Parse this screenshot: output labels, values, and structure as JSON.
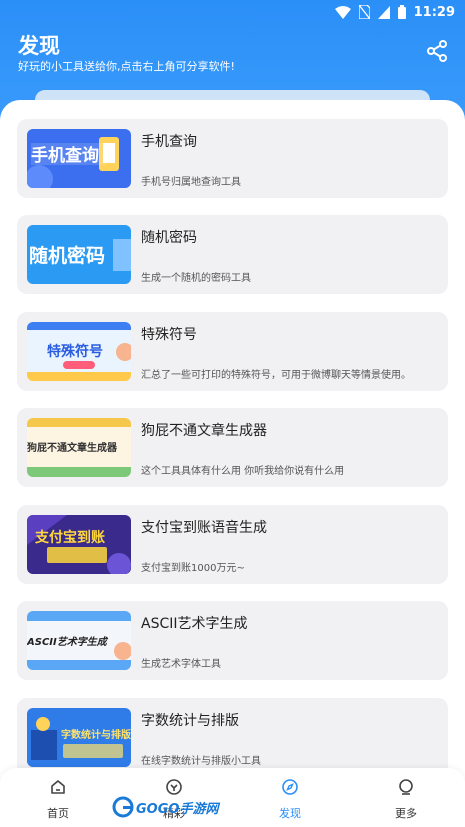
{
  "status": {
    "time": "11:29"
  },
  "header": {
    "title": "发现",
    "subtitle": "好玩的小工具送给你,点击右上角可分享软件!",
    "share_icon": "share-icon"
  },
  "colors": {
    "accent": "#2a8ff7",
    "card_bg": "#f1f1f3",
    "page_bg": "#ffffff"
  },
  "tools": [
    {
      "title": "手机查询",
      "desc": "手机号归属地查询工具",
      "thumb_text": "手机查询"
    },
    {
      "title": "随机密码",
      "desc": "生成一个随机的密码工具",
      "thumb_text": "随机密码"
    },
    {
      "title": "特殊符号",
      "desc": "汇总了一些可打印的特殊符号，可用于微博聊天等情景使用。",
      "thumb_text": "特殊符号"
    },
    {
      "title": "狗屁不通文章生成器",
      "desc": "这个工具具体有什么用 你听我给你说有什么用",
      "thumb_text": "狗屁不通文章生成器"
    },
    {
      "title": "支付宝到账语音生成",
      "desc": "支付宝到账1000万元~",
      "thumb_text": "支付宝到账"
    },
    {
      "title": "ASCII艺术字生成",
      "desc": "生成艺术字体工具",
      "thumb_text": "ASCII艺术字生成"
    },
    {
      "title": "字数统计与排版",
      "desc": "在线字数统计与排版小工具",
      "thumb_text": "字数统计与排版"
    }
  ],
  "tabbar": {
    "items": [
      {
        "label": "首页",
        "icon": "home-icon"
      },
      {
        "label": "精彩",
        "icon": "explore-icon"
      },
      {
        "label": "发现",
        "icon": "compass-icon"
      },
      {
        "label": "更多",
        "icon": "more-icon"
      }
    ],
    "active_index": 2
  },
  "watermark": {
    "text": "GOGO手游网"
  }
}
